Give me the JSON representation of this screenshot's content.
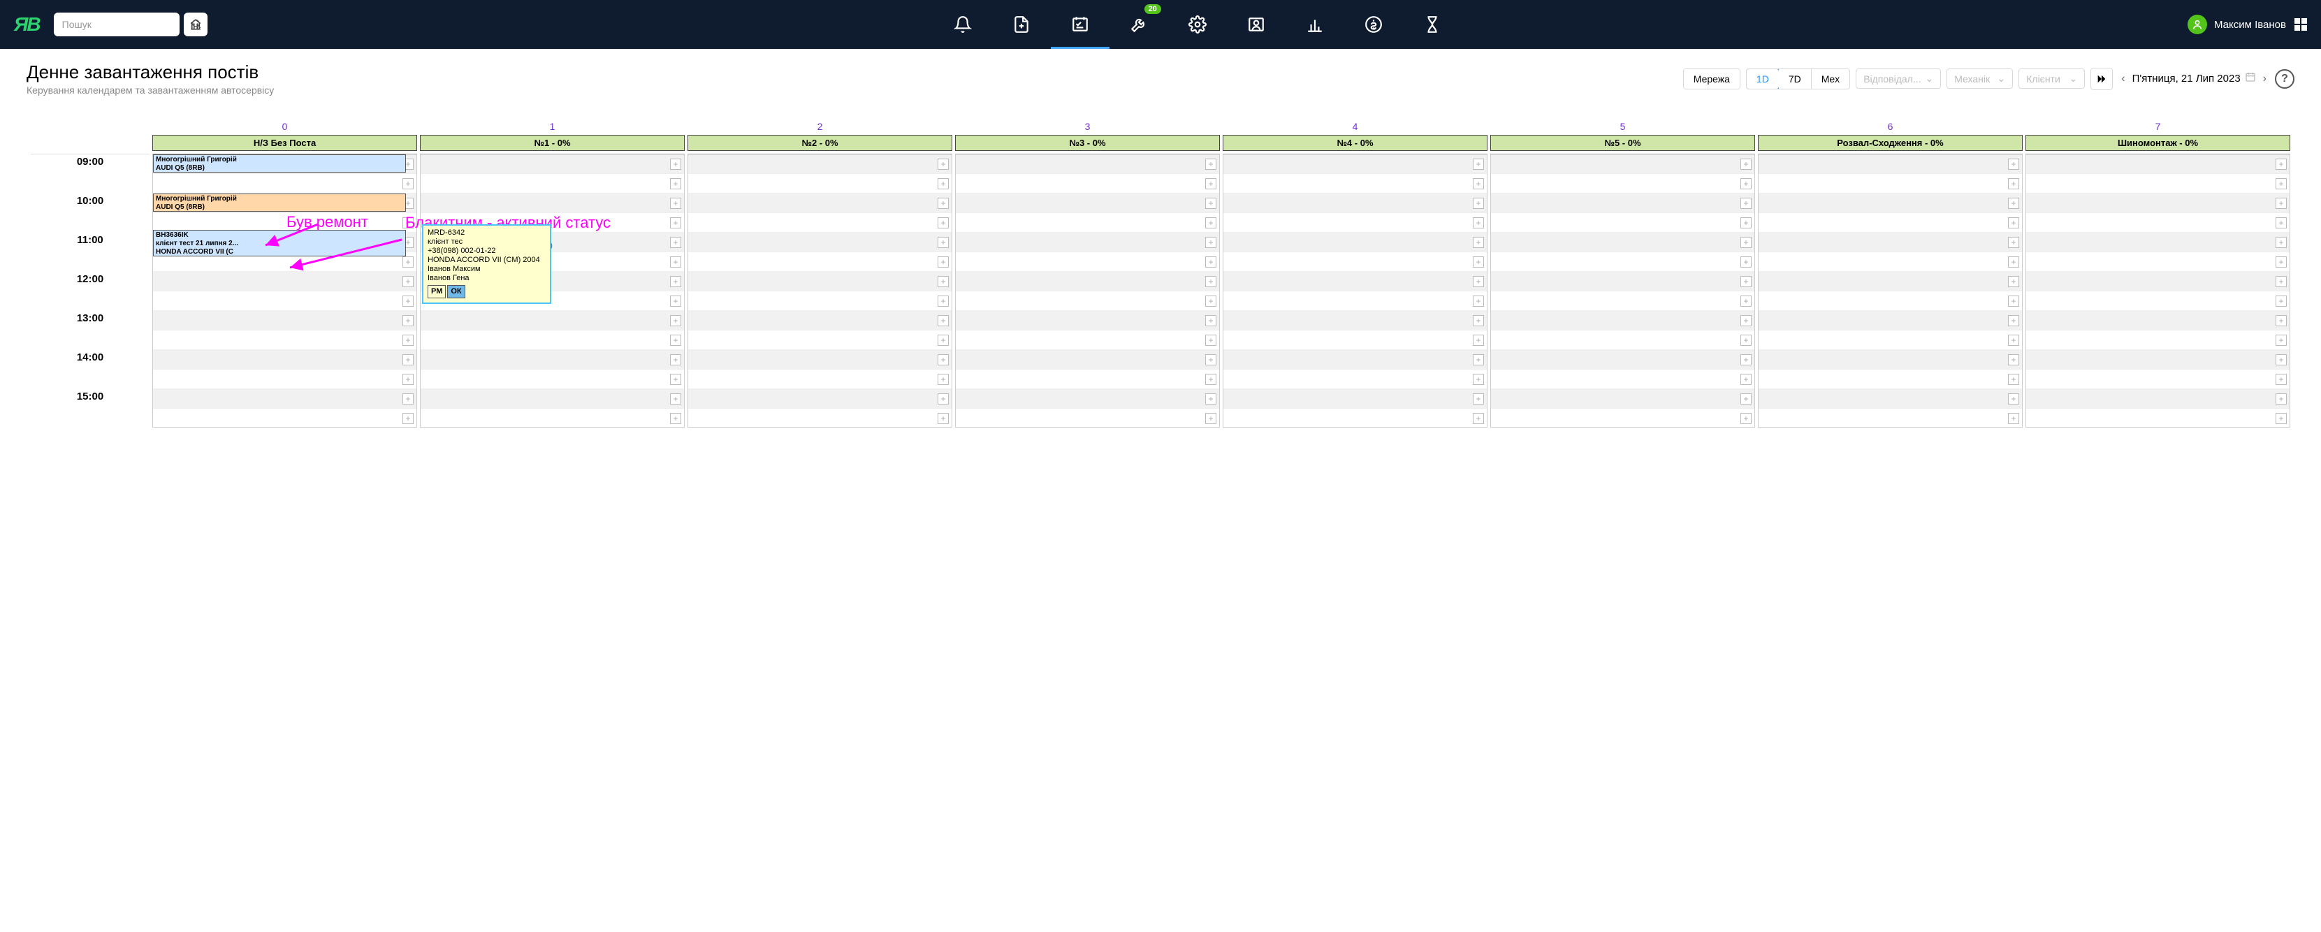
{
  "search": {
    "placeholder": "Пошук"
  },
  "badge_wrench": "20",
  "user": {
    "name": "Максим Іванов"
  },
  "page": {
    "title": "Денне завантаження постів",
    "subtitle": "Керування календарем та завантаженням автосервісу"
  },
  "toolbar": {
    "network": "Мережа",
    "d1": "1D",
    "d7": "7D",
    "mex": "Mex",
    "resp": "Відповідал...",
    "mech": "Механік",
    "clients": "Клієнти",
    "date": "П'ятниця, 21 Лип 2023",
    "help": "?"
  },
  "columns": {
    "nums": [
      "0",
      "1",
      "2",
      "3",
      "4",
      "5",
      "6",
      "7"
    ],
    "heads": [
      "Н/З Без Поста",
      "№1 - 0%",
      "№2 - 0%",
      "№3 - 0%",
      "№4 - 0%",
      "№5 - 0%",
      "Розвал-Сходження - 0%",
      "Шиномонтаж - 0%"
    ]
  },
  "hours": [
    "09:00",
    "10:00",
    "11:00",
    "12:00",
    "13:00",
    "14:00",
    "15:00"
  ],
  "cards": {
    "c1": {
      "l1": "Многогрішний Григорій",
      "l2": "AUDI Q5 (8RB)"
    },
    "c2": {
      "l1": "Многогрішний Григорій",
      "l2": "AUDI Q5 (8RB)"
    },
    "c3": {
      "l1": "BH3636IK",
      "l2": "клієнт тест 21 липня 2...",
      "l3": "HONDA ACCORD VII (C"
    }
  },
  "tip": {
    "l1": "MRD-6342",
    "l2": "клієнт тес",
    "l3": "+38(098) 002-01-22",
    "l4": "HONDA ACCORD VII (CM) 2004",
    "l5": "Іванов Максим",
    "l6": "Іванов Гена",
    "b1": "РМ",
    "b2": "ОК"
  },
  "annotations": {
    "a1": "Був ремонт",
    "a2": "Блакитним - активний статус",
    "a3": "Ок - виконано"
  }
}
